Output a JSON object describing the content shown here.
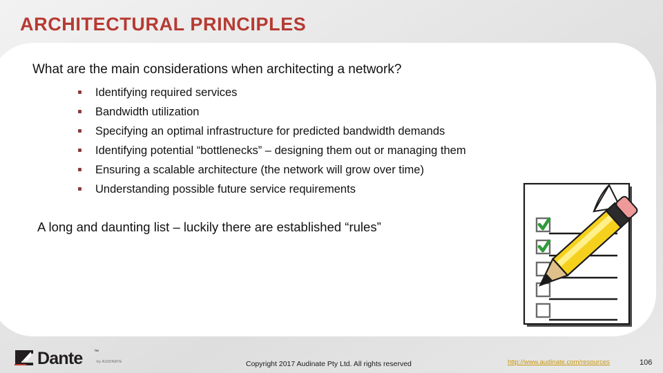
{
  "slide": {
    "title": "ARCHITECTURAL PRINCIPLES",
    "question": "What are the main considerations when architecting a network?",
    "bullets": [
      "Identifying required services",
      "Bandwidth utilization",
      "Specifying an optimal infrastructure for predicted bandwidth demands",
      "Identifying potential “bottlenecks” – designing them out or managing them",
      "Ensuring a scalable architecture (the network will grow over time)",
      "Understanding possible future service requirements"
    ],
    "summary": "A long and daunting list – luckily there are established “rules”"
  },
  "clipart": {
    "name": "checklist-with-pencil",
    "checklist_rows": [
      {
        "checked": true
      },
      {
        "checked": true
      },
      {
        "checked": false
      },
      {
        "checked": false
      },
      {
        "checked": false
      }
    ]
  },
  "footer": {
    "logo_word": "Dante",
    "logo_tm": "™",
    "logo_sub": "by AUDINATE",
    "copyright": "Copyright 2017 Audinate Pty Ltd. All rights reserved",
    "resource_link": "http://www.audinate.com/resources",
    "page_number": "106"
  },
  "colors": {
    "title_red": "#B63A32",
    "bullet_maroon": "#8C3A3A",
    "link_gold": "#C8960C",
    "pencil_yellow": "#F5D11E",
    "check_green": "#2E9B38",
    "eraser_pink": "#EF9A9A"
  }
}
